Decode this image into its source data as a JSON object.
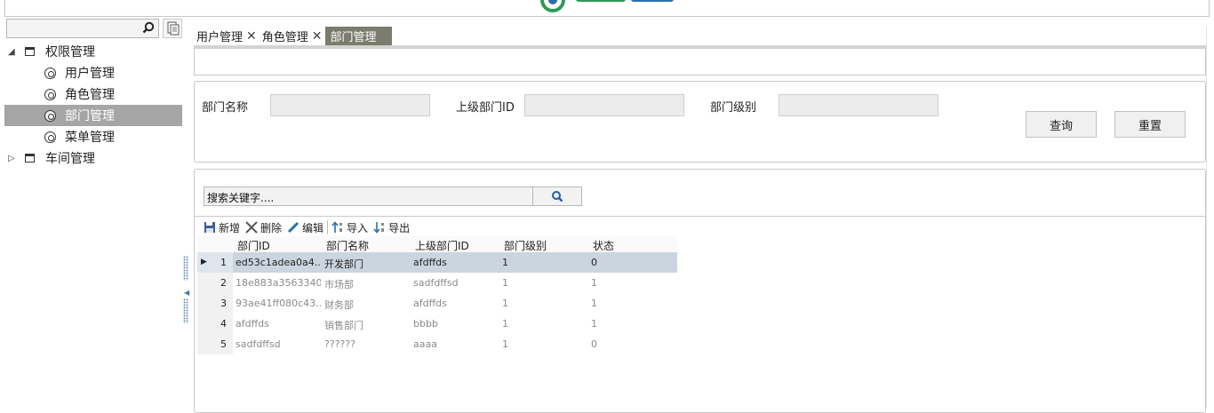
{
  "header": {
    "logo_icon": "company-logo"
  },
  "tree": {
    "search_placeholder": "",
    "items": [
      {
        "label": "权限管理",
        "level": 1,
        "expanded": true
      },
      {
        "label": "用户管理",
        "level": 2
      },
      {
        "label": "角色管理",
        "level": 2
      },
      {
        "label": "部门管理",
        "level": 2,
        "selected": true
      },
      {
        "label": "菜单管理",
        "level": 2
      },
      {
        "label": "车间管理",
        "level": 1,
        "expanded": false
      }
    ]
  },
  "tabs": [
    {
      "label": "用户管理",
      "close": "✕"
    },
    {
      "label": "角色管理",
      "close": "✕"
    },
    {
      "label": "部门管理",
      "active": true
    }
  ],
  "form": {
    "dept_name_label": "部门名称",
    "parent_id_label": "上级部门ID",
    "dept_level_label": "部门级别",
    "dept_name_value": "",
    "parent_id_value": "",
    "dept_level_value": "",
    "query_button": "查询",
    "reset_button": "重置"
  },
  "grid": {
    "search_placeholder": "搜索关键字....",
    "toolbar": {
      "add": "新增",
      "delete": "删除",
      "edit": "编辑",
      "import": "导入",
      "export": "导出"
    },
    "columns": [
      "部门ID",
      "部门名称",
      "上级部门ID",
      "部门级别",
      "状态"
    ],
    "rows": [
      {
        "num": "1",
        "id": "ed53c1adea0a4...",
        "name": "开发部门",
        "parent": "afdffds",
        "level": "1",
        "status": "0",
        "selected": true
      },
      {
        "num": "2",
        "id": "18e883a3563340...",
        "name": "市场部",
        "parent": "sadfdffsd",
        "level": "1",
        "status": "1"
      },
      {
        "num": "3",
        "id": "93ae41ff080c43...",
        "name": "财务部",
        "parent": "afdffds",
        "level": "1",
        "status": "1"
      },
      {
        "num": "4",
        "id": "afdffds",
        "name": "销售部门",
        "parent": "bbbb",
        "level": "1",
        "status": "1"
      },
      {
        "num": "5",
        "id": "sadfdffsd",
        "name": "??????",
        "parent": "aaaa",
        "level": "1",
        "status": "0"
      }
    ]
  },
  "colors": {
    "tab_active_bg": "#7b7b6e",
    "tree_selected_bg": "#a5a5a5",
    "row_selected_bg": "#cbd5df",
    "icon_blue": "#2a6fb0"
  }
}
